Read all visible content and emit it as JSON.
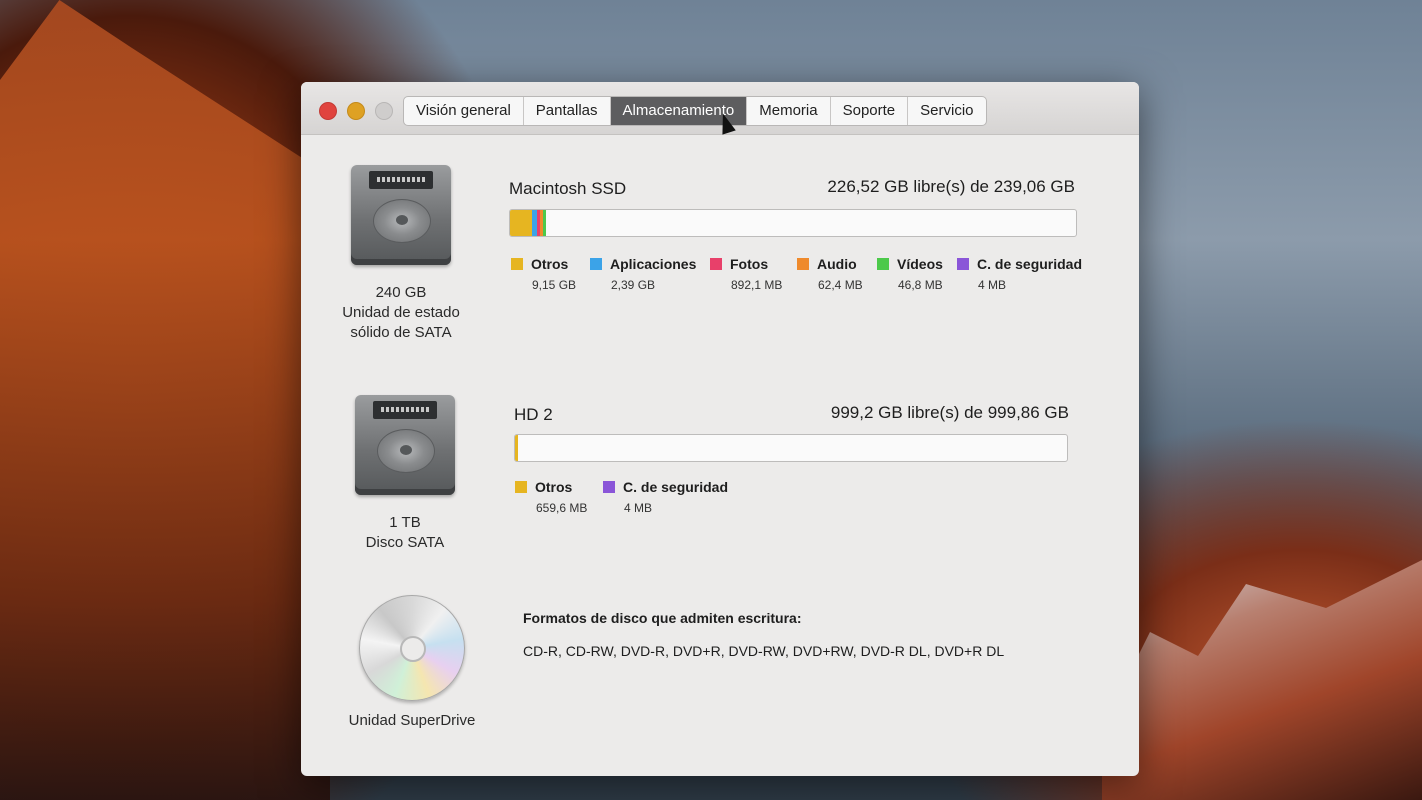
{
  "window": {
    "tabs": [
      {
        "label": "Visión general",
        "active": false
      },
      {
        "label": "Pantallas",
        "active": false
      },
      {
        "label": "Almacenamiento",
        "active": true
      },
      {
        "label": "Memoria",
        "active": false
      },
      {
        "label": "Soporte",
        "active": false
      },
      {
        "label": "Servicio",
        "active": false
      }
    ]
  },
  "colors": {
    "otros": "#e6b521",
    "aplicaciones": "#3ba3e8",
    "fotos": "#e8406a",
    "audio": "#ef8a2c",
    "videos": "#4cc94a",
    "backup": "#8a55d8"
  },
  "drives": [
    {
      "icon": "hard-drive-icon",
      "capacity": "240 GB",
      "type_line1": "Unidad de estado",
      "type_line2": "sólido de SATA",
      "name": "Macintosh SSD",
      "free": "226,52 GB libre(s) de 239,06 GB",
      "used_fraction": 0.0523,
      "legend": [
        {
          "key": "otros",
          "label": "Otros",
          "size": "9,15 GB",
          "fraction": 0.0383
        },
        {
          "key": "aplicaciones",
          "label": "Aplicaciones",
          "size": "2,39 GB",
          "fraction": 0.01
        },
        {
          "key": "fotos",
          "label": "Fotos",
          "size": "892,1 MB",
          "fraction": 0.0037
        },
        {
          "key": "audio",
          "label": "Audio",
          "size": "62,4 MB",
          "fraction": 0.0003
        },
        {
          "key": "videos",
          "label": "Vídeos",
          "size": "46,8 MB",
          "fraction": 0.0002
        },
        {
          "key": "backup",
          "label": "C. de seguridad",
          "size": "4 MB",
          "fraction": 0.0
        }
      ]
    },
    {
      "icon": "hard-drive-icon",
      "capacity": "1 TB",
      "type_line1": "Disco SATA",
      "name": "HD 2",
      "free": "999,2 GB libre(s) de 999,86 GB",
      "used_fraction": 0.0007,
      "legend": [
        {
          "key": "otros",
          "label": "Otros",
          "size": "659,6 MB",
          "fraction": 0.0007
        },
        {
          "key": "backup",
          "label": "C. de seguridad",
          "size": "4 MB",
          "fraction": 0.0
        }
      ]
    }
  ],
  "superdrive": {
    "icon": "optical-disc-icon",
    "name": "Unidad SuperDrive",
    "formats_title": "Formatos de disco que admiten escritura:",
    "formats": "CD-R, CD-RW, DVD-R, DVD+R, DVD-RW, DVD+RW, DVD-R DL, DVD+R DL"
  }
}
